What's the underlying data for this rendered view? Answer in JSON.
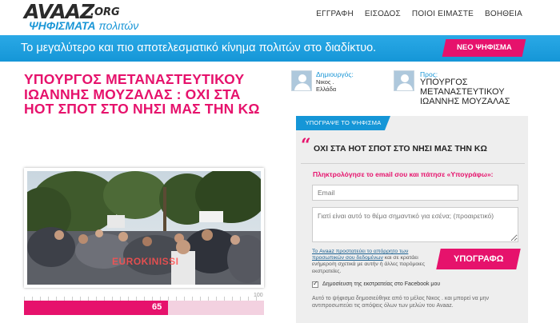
{
  "header": {
    "logo": "AVAAZ",
    "logo_suffix": ".ORG",
    "logo_sub_bold": "ΨΗΦΙΣΜΑΤΑ",
    "logo_sub_rest": " πολιτών",
    "nav": [
      "ΕΓΓΡΑΦΗ",
      "ΕΙΣΟΔΟΣ",
      "ΠΟΙΟΙ ΕΙΜΑΣΤΕ",
      "ΒΟΗΘΕΙΑ"
    ]
  },
  "banner": {
    "text": "Το μεγαλύτερο και πιο αποτελεσματικό κίνημα πολιτών στο διαδίκτυο.",
    "new_petition_label": "ΝΕΟ ΨΗΦΙΣΜΑ"
  },
  "petition": {
    "title": "ΥΠΟΥΡΓΟΣ ΜΕΤΑΝΑΣΤΕΥΤΙΚΟΥ ΙΩΑΝΝΗΣ ΜΟΥΖΑΛΑΣ : ΟΧΙ ΣΤΑ ΗΟΤ ΣΠΟΤ ΣΤΟ ΝΗΣΙ ΜΑΣ ΤΗΝ ΚΩ",
    "photo_watermark": "EUROKINISSI",
    "signatures": 65,
    "goal": 100,
    "progress_fraction": 0.6
  },
  "creator": {
    "label": "Δημιουργός:",
    "name": "Νικος .",
    "location": "Ελλάδα"
  },
  "recipient": {
    "label": "Προς:",
    "name": "ΥΠΟΥΡΓΟΣ ΜΕΤΑΝΑΣΤΕΥΤΙΚΟΥ ΙΩΑΝΝΗΣ ΜΟΥΖΑΛΑΣ"
  },
  "sign_form": {
    "tab_label": "ΥΠΟΓΡΑΨΕ ΤΟ ΨΗΦΙΣΜΑ",
    "quote_mark": "“",
    "heading": "ΟΧΙ ΣΤΑ ΗΟΤ ΣΠΟΤ ΣΤΟ ΝΗΣΙ ΜΑΣ ΤΗΝ ΚΩ",
    "email_prompt": "Πληκτρολόγησε το email σου και πάτησε «Υπογράφω»:",
    "email_placeholder": "Email",
    "comment_placeholder": "Γιατί είναι αυτό το θέμα σημαντικό για εσένα; (προαιρετικό)",
    "privacy_link": "Το Avaaz προστατεύει το απόρρητο των προσωπικών σου δεδομένων",
    "privacy_rest": " και σε κρατάει ενήμερο/η σχετικά με αυτήν ή άλλες παρόμοιες εκστρατείες.",
    "sign_button": "ΥΠΟΓΡΑΦΩ",
    "facebook_label": "Δημοσίευση της εκστρατείας στο Facebook μου",
    "disclaimer": "Αυτό το ψήφισμα δημοσιεύθηκε από το μέλος Νικος . και μπορεί να μην αντιπροσωπεύει τις απόψεις όλων των μελών του Avaaz."
  },
  "colors": {
    "accent_pink": "#e6126c",
    "accent_blue": "#1596d7"
  }
}
